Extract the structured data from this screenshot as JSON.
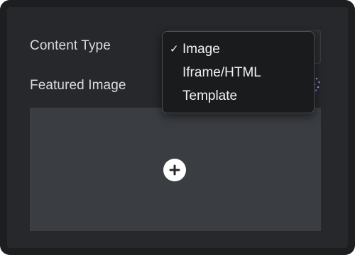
{
  "fields": {
    "content_type_label": "Content Type",
    "featured_image_label": "Featured Image"
  },
  "content_type_select": {
    "selected": "Image",
    "check_mark": "✓",
    "options": [
      {
        "label": "Image",
        "selected": true
      },
      {
        "label": "Iframe/HTML",
        "selected": false
      },
      {
        "label": "Template",
        "selected": false
      }
    ]
  },
  "icons": {
    "add_image": "plus-circle-icon",
    "ai_sparkle": "sparkle-icon"
  },
  "colors": {
    "panel_bg": "#26282b",
    "image_area_bg": "#3a3d42",
    "dropdown_bg": "#1a1b1d",
    "sparkle_accent": "#c77be0"
  }
}
